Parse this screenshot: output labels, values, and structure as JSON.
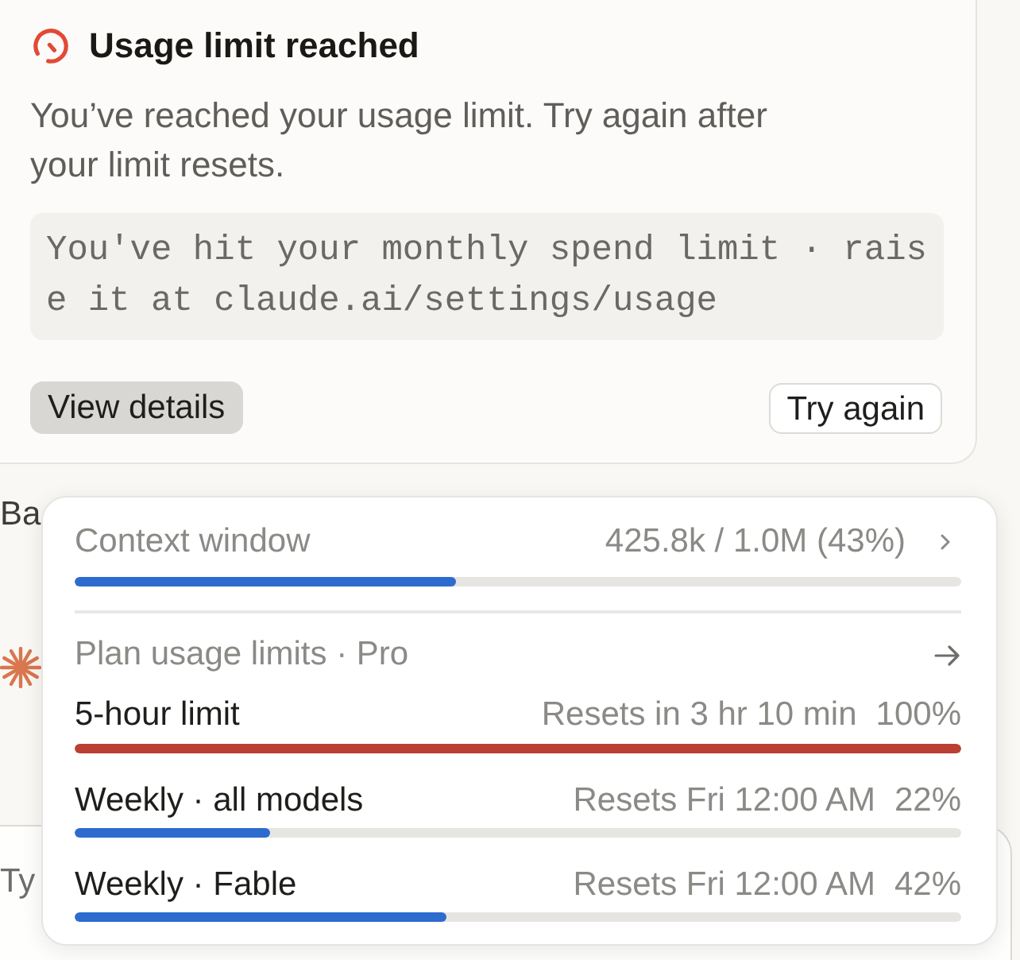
{
  "alert": {
    "title": "Usage limit reached",
    "message": "You’ve reached your usage limit. Try again after your limit resets.",
    "detail": "You've hit your monthly spend limit · raise it at claude.ai/settings/usage",
    "buttons": [
      {
        "label": "View details",
        "kind": "secondary"
      },
      {
        "label": "Try again",
        "kind": "outline"
      }
    ]
  },
  "conversation": {
    "message": "Ba"
  },
  "composer": {
    "placeholder": "Ty"
  },
  "usage_popover": {
    "context": {
      "label": "Context window",
      "reading": "425.8k / 1.0M (43%)",
      "level": 0.43
    },
    "plan": {
      "label": "Plan usage limits · Pro"
    },
    "limits": [
      {
        "name": "5-hour limit",
        "resets": "Resets in 3 hr 10 min",
        "reading": "100%",
        "level": 1,
        "color": "#bc3f33"
      },
      {
        "name": "Weekly · all models",
        "resets": "Resets Fri 12:00 AM",
        "reading": "22%",
        "level": 0.22,
        "color": "#2d6bcf"
      },
      {
        "name": "Weekly · Fable",
        "resets": "Resets Fri 12:00 AM",
        "reading": "42%",
        "level": 0.42,
        "color": "#2d6bcf"
      }
    ]
  }
}
